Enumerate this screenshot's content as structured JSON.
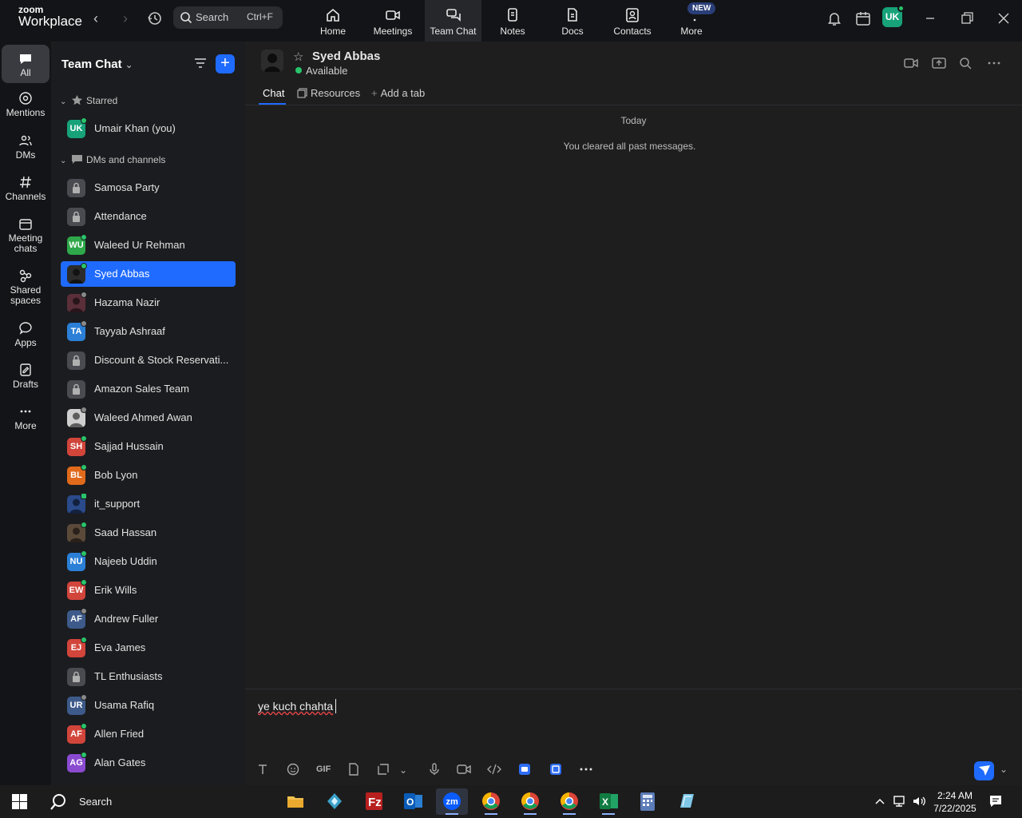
{
  "app": {
    "logo_line1": "zoom",
    "logo_line2": "Workplace"
  },
  "top_search": {
    "label": "Search",
    "shortcut": "Ctrl+F"
  },
  "top_tabs": [
    {
      "label": "Home",
      "icon": "home-icon"
    },
    {
      "label": "Meetings",
      "icon": "video-icon"
    },
    {
      "label": "Team Chat",
      "icon": "chat-icon",
      "active": true
    },
    {
      "label": "Notes",
      "icon": "notes-icon"
    },
    {
      "label": "Docs",
      "icon": "docs-icon"
    },
    {
      "label": "Contacts",
      "icon": "contacts-icon"
    },
    {
      "label": "More",
      "icon": "more-icon"
    }
  ],
  "new_badge": "NEW",
  "user_initials": "UK",
  "rail": [
    {
      "label": "All",
      "active": true
    },
    {
      "label": "Mentions"
    },
    {
      "label": "DMs"
    },
    {
      "label": "Channels"
    },
    {
      "label": "Meeting chats"
    },
    {
      "label": "Shared spaces"
    },
    {
      "label": "Apps"
    },
    {
      "label": "Drafts"
    },
    {
      "label": "More"
    }
  ],
  "sidebar": {
    "title": "Team Chat",
    "starred_label": "Starred",
    "dms_label": "DMs and channels",
    "starred": [
      {
        "name": "Umair Khan (you)",
        "initials": "UK",
        "color": "#17a27a",
        "status": "on"
      }
    ],
    "items": [
      {
        "name": "Samosa Party",
        "kind": "lock"
      },
      {
        "name": "Attendance",
        "kind": "lock"
      },
      {
        "name": "Waleed Ur Rehman",
        "initials": "WU",
        "color": "#2ea84a",
        "status": "on"
      },
      {
        "name": "Syed Abbas",
        "kind": "photo",
        "status": "on",
        "selected": true
      },
      {
        "name": "Hazama Nazir",
        "kind": "photo",
        "color": "#5a2f3a",
        "status": "off"
      },
      {
        "name": "Tayyab Ashraaf",
        "initials": "TA",
        "color": "#2b7fd6",
        "status": "off"
      },
      {
        "name": "Discount & Stock Reservati...",
        "kind": "lock"
      },
      {
        "name": "Amazon Sales Team",
        "kind": "lock"
      },
      {
        "name": "Waleed Ahmed Awan",
        "kind": "photo",
        "color": "#cfcfcf",
        "status": "off"
      },
      {
        "name": "Sajjad Hussain",
        "initials": "SH",
        "color": "#d1453b",
        "status": "on"
      },
      {
        "name": "Bob Lyon",
        "initials": "BL",
        "color": "#e06a1b",
        "status": "on"
      },
      {
        "name": "it_support",
        "kind": "photo",
        "color": "#2a4a8a",
        "status": "ext"
      },
      {
        "name": "Saad Hassan",
        "kind": "photo",
        "color": "#5b4a3a",
        "status": "on"
      },
      {
        "name": "Najeeb Uddin",
        "initials": "NU",
        "color": "#2b7fd6",
        "status": "on"
      },
      {
        "name": "Erik Wills",
        "initials": "EW",
        "color": "#d1453b",
        "status": "on"
      },
      {
        "name": "Andrew Fuller",
        "initials": "AF",
        "color": "#3d5a8a",
        "status": "off"
      },
      {
        "name": "Eva James",
        "initials": "EJ",
        "color": "#d1453b",
        "status": "on"
      },
      {
        "name": "TL Enthusiasts",
        "kind": "lock"
      },
      {
        "name": "Usama Rafiq",
        "initials": "UR",
        "color": "#3d5a8a",
        "status": "off"
      },
      {
        "name": "Allen Fried",
        "initials": "AF",
        "color": "#d1453b",
        "status": "on"
      },
      {
        "name": "Alan Gates",
        "initials": "AG",
        "color": "#8a4bd1",
        "status": "on"
      }
    ]
  },
  "chat": {
    "name": "Syed Abbas",
    "status": "Available",
    "tabs": {
      "chat": "Chat",
      "resources": "Resources",
      "add": "Add a tab"
    },
    "day": "Today",
    "system_message": "You cleared all past messages.",
    "draft_text": "ye kuch chahta"
  },
  "taskbar": {
    "search": "Search",
    "time": "2:24 AM",
    "date": "7/22/2025"
  }
}
